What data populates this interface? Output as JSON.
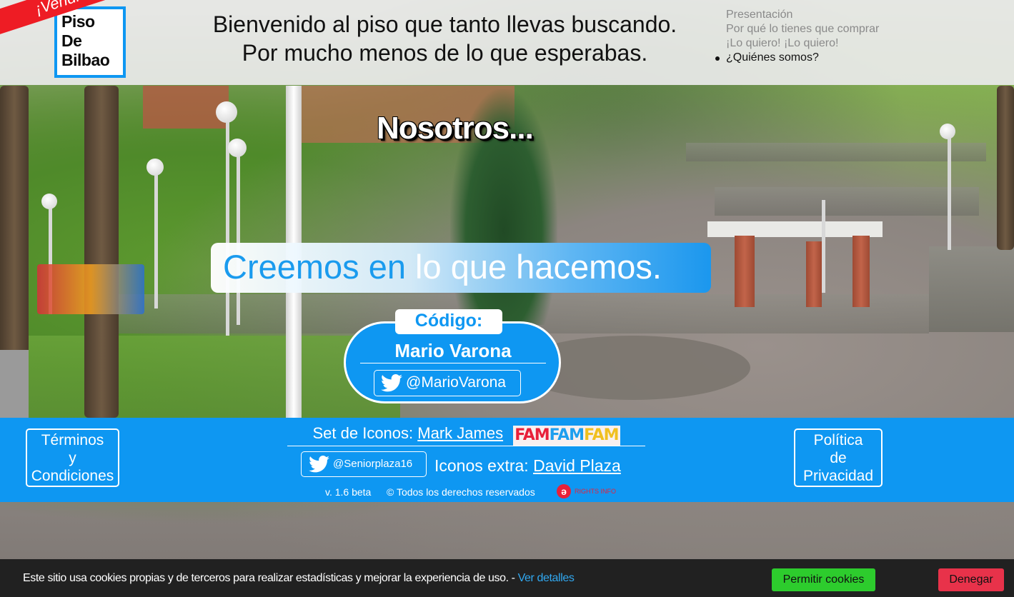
{
  "header": {
    "logo_text": "Piso\nDe\nBilbao",
    "sold_ribbon": "¡Vendido!",
    "title_line1": "Bienvenido al piso que tanto llevas buscando.",
    "title_line2": "Por mucho menos de lo que esperabas.",
    "nav": [
      {
        "label": "Presentación",
        "active": false
      },
      {
        "label": "Por qué lo tienes que comprar",
        "active": false
      },
      {
        "label": "¡Lo quiero! ¡Lo quiero!",
        "active": false
      },
      {
        "label": "¿Quiénes somos?",
        "active": true
      }
    ]
  },
  "hero": {
    "section_title": "Nosotros...",
    "motto_part1": "Creemos en",
    "motto_part2": " lo que hacemos."
  },
  "code_card": {
    "label": "Código:",
    "name": "Mario Varona",
    "twitter": "@MarioVarona",
    "twitter_icon": "twitter-bird-icon"
  },
  "footer": {
    "terms_lines": [
      "Términos",
      "y",
      "Condiciones"
    ],
    "privacy_lines": [
      "Política",
      "de",
      "Privacidad"
    ],
    "icon_set_label": "Set de Iconos:",
    "icon_set_author": "Mark James",
    "famfam_logo": [
      "FAM",
      "FAM",
      "FAM"
    ],
    "twitter": "@Seniorplaza16",
    "extra_icons_label": "Iconos extra:",
    "extra_icons_author": "David Plaza",
    "version": "v. 1.6 beta",
    "rights": "© Todos los derechos reservados",
    "rights_info": "RIGHTS INFO"
  },
  "cookies": {
    "text": "Este sitio usa cookies propias y de terceros para realizar estadísticas y mejorar la experiencia de uso. - ",
    "details_link": "Ver detalles",
    "allow_button": "Permitir cookies",
    "deny_button": "Denegar"
  },
  "colors": {
    "brand_blue": "#0e97f2",
    "sold_red": "#ee1c24",
    "allow_green": "#2dcc2d",
    "deny_red": "#e8324a",
    "cookie_bg": "#212121"
  }
}
